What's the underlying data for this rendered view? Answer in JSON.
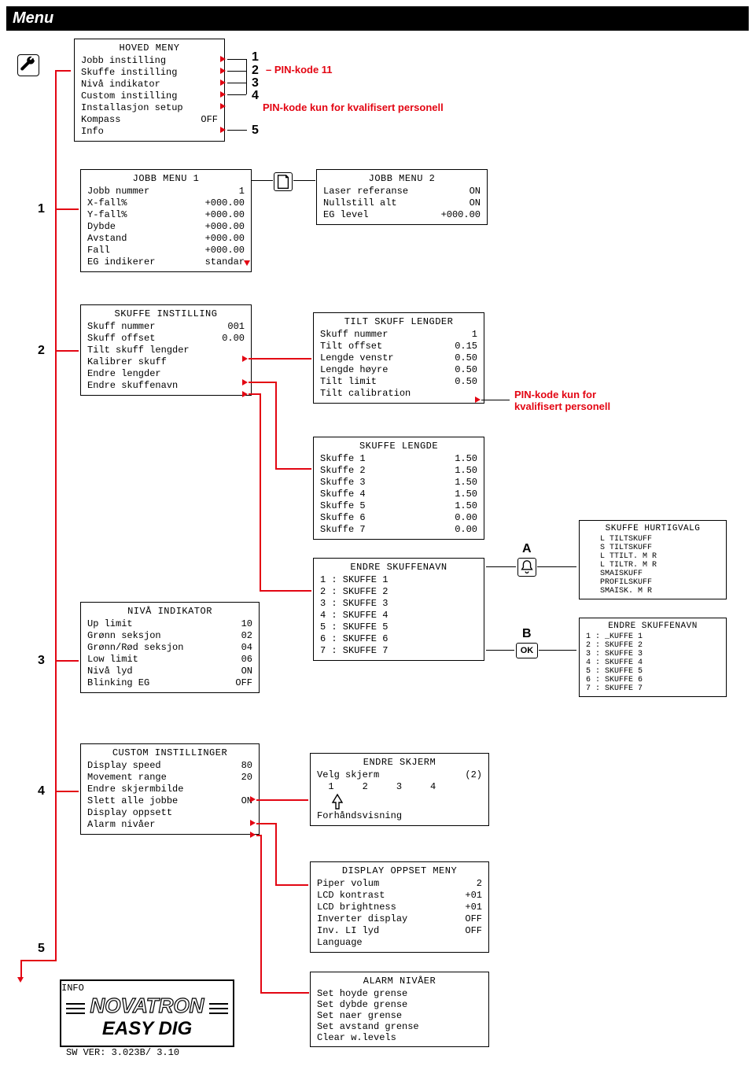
{
  "title": "Menu",
  "hoved": {
    "title": "HOVED MENY",
    "items": [
      {
        "l": "Jobb instilling",
        "r": ""
      },
      {
        "l": "Skuffe instilling",
        "r": ""
      },
      {
        "l": "Nivå indikator",
        "r": ""
      },
      {
        "l": "Custom instilling",
        "r": ""
      },
      {
        "l": "Installasjon setup",
        "r": ""
      },
      {
        "l": "Kompass",
        "r": "OFF"
      },
      {
        "l": "Info",
        "r": ""
      }
    ],
    "side": {
      "n1": "1",
      "n2": "2",
      "n3": "3",
      "n4": "4",
      "n5": "5"
    },
    "ann_pin11": "PIN-kode 11",
    "ann_pin_q": "PIN-kode kun for kvalifisert personell"
  },
  "jobb1": {
    "title": "JOBB MENU 1",
    "items": [
      {
        "l": "Jobb nummer",
        "r": "1"
      },
      {
        "l": "X-fall%",
        "r": "+000.00"
      },
      {
        "l": "Y-fall%",
        "r": "+000.00"
      },
      {
        "l": "Dybde",
        "r": "+000.00"
      },
      {
        "l": "Avstand",
        "r": "+000.00"
      },
      {
        "l": "Fall",
        "r": "+000.00"
      },
      {
        "l": "EG indikerer",
        "r": "standar"
      }
    ]
  },
  "jobb2": {
    "title": "JOBB MENU 2",
    "items": [
      {
        "l": "Laser referanse",
        "r": "ON"
      },
      {
        "l": "Nullstill alt",
        "r": "ON"
      },
      {
        "l": "EG level",
        "r": "+000.00"
      }
    ]
  },
  "skuffe": {
    "title": "SKUFFE INSTILLING",
    "items": [
      {
        "l": "Skuff nummer",
        "r": "001"
      },
      {
        "l": "Skuff offset",
        "r": "0.00"
      },
      {
        "l": "",
        "r": ""
      },
      {
        "l": "Tilt skuff lengder",
        "r": ""
      },
      {
        "l": "Kalibrer skuff",
        "r": ""
      },
      {
        "l": "Endre lengder",
        "r": ""
      },
      {
        "l": "Endre skuffenavn",
        "r": ""
      }
    ]
  },
  "tilt": {
    "title": "TILT SKUFF LENGDER",
    "items": [
      {
        "l": "Skuff nummer",
        "r": "1"
      },
      {
        "l": "Tilt offset",
        "r": "0.15"
      },
      {
        "l": "Lengde venstr",
        "r": "0.50"
      },
      {
        "l": "Lengde høyre",
        "r": "0.50"
      },
      {
        "l": "Tilt limit",
        "r": "0.50"
      },
      {
        "l": "",
        "r": ""
      },
      {
        "l": "Tilt calibration",
        "r": ""
      }
    ],
    "ann": "PIN-kode kun for\nkvalifisert personell"
  },
  "skuffe_len": {
    "title": "SKUFFE LENGDE",
    "items": [
      {
        "l": "Skuffe 1",
        "r": "1.50"
      },
      {
        "l": "Skuffe 2",
        "r": "1.50"
      },
      {
        "l": "Skuffe 3",
        "r": "1.50"
      },
      {
        "l": "Skuffe 4",
        "r": "1.50"
      },
      {
        "l": "Skuffe 5",
        "r": "1.50"
      },
      {
        "l": "Skuffe 6",
        "r": "0.00"
      },
      {
        "l": "Skuffe 7",
        "r": "0.00"
      }
    ]
  },
  "endre_sk": {
    "title": "ENDRE SKUFFENAVN",
    "items": [
      {
        "l": "1 : SKUFFE 1",
        "r": ""
      },
      {
        "l": "2 : SKUFFE 2",
        "r": ""
      },
      {
        "l": "3 : SKUFFE 3",
        "r": ""
      },
      {
        "l": "4 : SKUFFE 4",
        "r": ""
      },
      {
        "l": "5 : SKUFFE 5",
        "r": ""
      },
      {
        "l": "6 : SKUFFE 6",
        "r": ""
      },
      {
        "l": "7 : SKUFFE 7",
        "r": ""
      }
    ]
  },
  "niva": {
    "title": "NIVÅ INDIKATOR",
    "items": [
      {
        "l": "Up limit",
        "r": "10"
      },
      {
        "l": "Grønn seksjon",
        "r": "02"
      },
      {
        "l": "Grønn/Rød seksjon",
        "r": "04"
      },
      {
        "l": "Low limit",
        "r": "06"
      },
      {
        "l": "Nivå lyd",
        "r": "ON"
      },
      {
        "l": "Blinking EG",
        "r": "OFF"
      }
    ]
  },
  "hurtig": {
    "title": "SKUFFE HURTIGVALG",
    "items": [
      "L TILTSKUFF",
      "S TILTSKUFF",
      "L TTILT. M R",
      "L TILTR. M R",
      "SMAISKUFF",
      "PROFILSKUFF",
      "SMAISK. M R"
    ]
  },
  "endre_sk2": {
    "title": "ENDRE SKUFFENAVN",
    "items": [
      "1 : _KUFFE 1",
      "2 : SKUFFE 2",
      "3 : SKUFFE 3",
      "4 : SKUFFE 4",
      "5 : SKUFFE 5",
      "6 : SKUFFE 6",
      "7 : SKUFFE 7"
    ]
  },
  "custom": {
    "title": "CUSTOM INSTILLINGER",
    "items": [
      {
        "l": "Display speed",
        "r": "80"
      },
      {
        "l": "Movement range",
        "r": "20"
      },
      {
        "l": "",
        "r": ""
      },
      {
        "l": "Endre skjermbilde",
        "r": ""
      },
      {
        "l": "Slett alle jobbe",
        "r": "ON"
      },
      {
        "l": "Display oppsett",
        "r": ""
      },
      {
        "l": "Alarm nivåer",
        "r": ""
      }
    ]
  },
  "endre_skjerm": {
    "title": "ENDRE SKJERM",
    "velg": "Velg skjerm",
    "velg_n": "(2)",
    "nums": "  1     2     3     4",
    "forhands": "Forhåndsvisning"
  },
  "disp_opp": {
    "title": "DISPLAY OPPSET MENY",
    "items": [
      {
        "l": "Piper volum",
        "r": "2"
      },
      {
        "l": "LCD kontrast",
        "r": "+01"
      },
      {
        "l": "LCD brightness",
        "r": "+01"
      },
      {
        "l": "Inverter display",
        "r": "OFF"
      },
      {
        "l": "Inv. LI lyd",
        "r": "OFF"
      },
      {
        "l": "Language",
        "r": ""
      }
    ]
  },
  "alarm": {
    "title": "ALARM NIVÅER",
    "items": [
      "Set hoyde grense",
      "Set dybde grense",
      "Set naer grense",
      "Set avstand grense",
      "Clear w.levels"
    ]
  },
  "info": {
    "title": "INFO",
    "brand": "NOVATRON",
    "product": "EASY DIG",
    "swver": "SW  VER:  3.023B/ 3.10"
  },
  "sideletters": {
    "A": "A",
    "B": "B",
    "OK": "OK"
  }
}
